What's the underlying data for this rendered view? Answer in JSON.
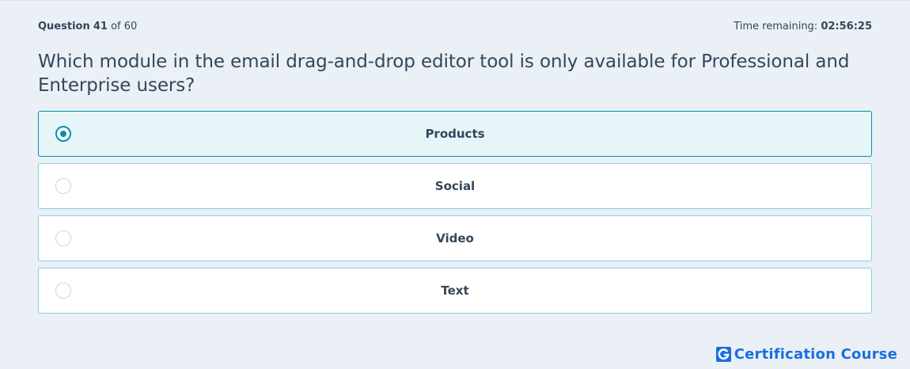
{
  "header": {
    "question_label": "Question",
    "question_number": "41",
    "question_of": "of 60",
    "time_label": "Time remaining:",
    "time_value": "02:56:25"
  },
  "question": {
    "text": "Which module in the email drag-and-drop editor tool is only available for Professional and Enterprise users?"
  },
  "options": [
    {
      "label": "Products",
      "selected": true
    },
    {
      "label": "Social",
      "selected": false
    },
    {
      "label": "Video",
      "selected": false
    },
    {
      "label": "Text",
      "selected": false
    }
  ],
  "brand": {
    "icon": "g-logo-icon",
    "text": "Certification Course"
  },
  "colors": {
    "background": "#eaf0f6",
    "text": "#33475b",
    "accent": "#0091ae",
    "option_border": "#7fd1de",
    "selected_bg": "#e5f5f8",
    "brand": "#1a6fde"
  }
}
